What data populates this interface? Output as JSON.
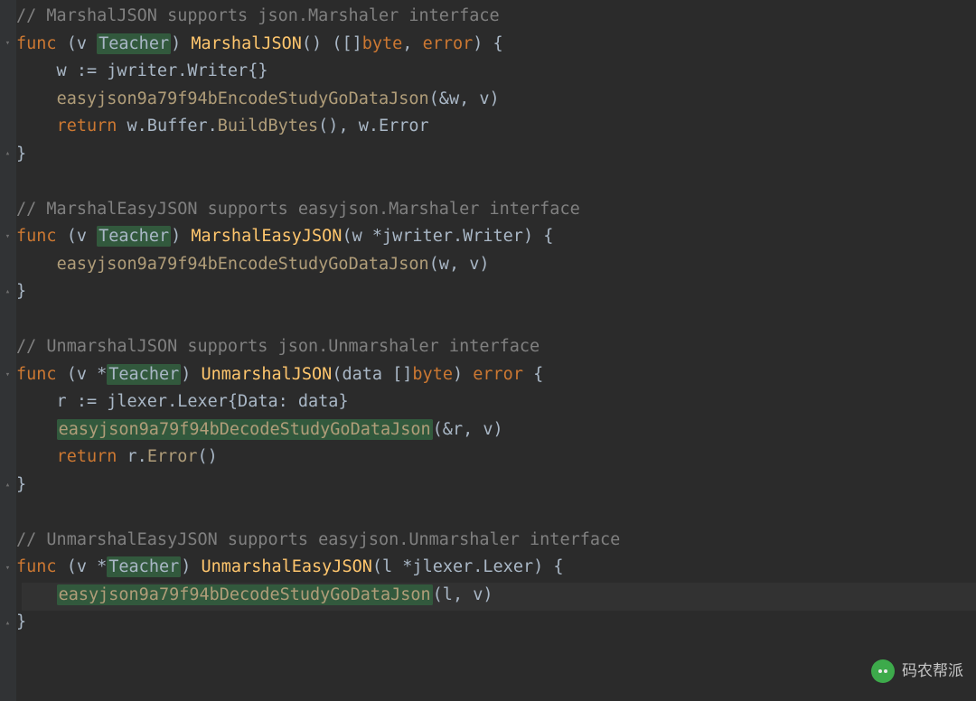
{
  "colors": {
    "background": "#2B2B2B",
    "gutter": "#313335",
    "comment": "#808080",
    "keyword": "#CC7832",
    "funcName": "#FFC66D",
    "field": "#9876AA",
    "usageHighlight": "#32593D",
    "default": "#A9B7C6"
  },
  "watermark": {
    "label": "码农帮派"
  },
  "code": {
    "l1": "// MarshalJSON supports json.Marshaler interface",
    "l2_func": "func",
    "l2_v": "(v ",
    "l2_type": "Teacher",
    "l2_close": ") ",
    "l2_name": "MarshalJSON",
    "l2_sig": "() ([]",
    "l2_byte": "byte",
    "l2_sig2": ", ",
    "l2_err": "error",
    "l2_sig3": ") {",
    "l3_a": "    w := jwriter.",
    "l3_b": "Writer",
    "l3_c": "{}",
    "l4_a": "    ",
    "l4_b": "easyjson9a79f94bEncodeStudyGoDataJson",
    "l4_c": "(&w, v)",
    "l5_a": "    ",
    "l5_ret": "return ",
    "l5_b": "w.Buffer.",
    "l5_c": "BuildBytes",
    "l5_d": "(), w.Error",
    "l6": "}",
    "l8": "// MarshalEasyJSON supports easyjson.Marshaler interface",
    "l9_name": "MarshalEasyJSON",
    "l9_sig": "(w *jwriter.",
    "l9_writer": "Writer",
    "l9_sig2": ") {",
    "l10_a": "    ",
    "l10_b": "easyjson9a79f94bEncodeStudyGoDataJson",
    "l10_c": "(w, v)",
    "l11": "}",
    "l13": "// UnmarshalJSON supports json.Unmarshaler interface",
    "l14_v": "(v *",
    "l14_name": "UnmarshalJSON",
    "l14_sig": "(data []",
    "l14_byte": "byte",
    "l14_sig2": ") ",
    "l14_err": "error",
    "l14_sig3": " {",
    "l15_a": "    r := jlexer.",
    "l15_b": "Lexer",
    "l15_c": "{Data: data}",
    "l16_a": "    ",
    "l16_b": "easyjson9a79f94bDecodeStudyGoDataJson",
    "l16_c": "(&r, v)",
    "l17_a": "    ",
    "l17_ret": "return ",
    "l17_b": "r.",
    "l17_c": "Error",
    "l17_d": "()",
    "l18": "}",
    "l20": "// UnmarshalEasyJSON supports easyjson.Unmarshaler interface",
    "l21_name": "UnmarshalEasyJSON",
    "l21_sig": "(l *jlexer.",
    "l21_lexer": "Lexer",
    "l21_sig2": ") {",
    "l22_a": "    ",
    "l22_b": "easyjson9a79f94bDecodeStudyGoDataJson",
    "l22_c": "(l, v)",
    "l23": "}"
  }
}
